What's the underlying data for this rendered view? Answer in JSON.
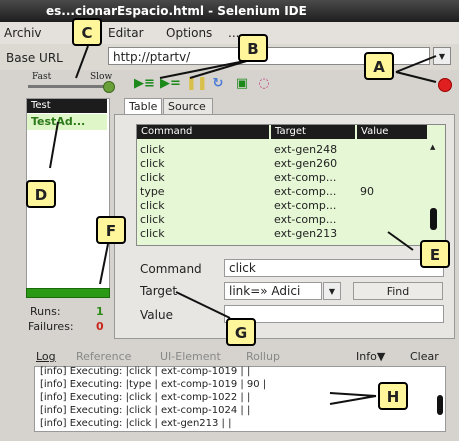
{
  "window": {
    "title": "es...cionarEspacio.html - Selenium IDE"
  },
  "menu": {
    "items": [
      "Archiv",
      "Editar",
      "Options",
      "..."
    ]
  },
  "baseurl": {
    "label": "Base URL",
    "value": "http://ptartv/"
  },
  "speed": {
    "fast": "Fast",
    "slow": "Slow"
  },
  "toolbar": {
    "icons": [
      "play-all-icon",
      "play-current-icon",
      "pause-icon",
      "step-icon",
      "rollup-icon",
      "schedule-icon"
    ]
  },
  "testcases": {
    "header": "Test",
    "items": [
      "TestAd..."
    ]
  },
  "stats": {
    "runs_label": "Runs:",
    "runs_value": "1",
    "failures_label": "Failures:",
    "failures_value": "0"
  },
  "tabs": {
    "table": "Table",
    "source": "Source"
  },
  "table": {
    "headers": [
      "Command",
      "Target",
      "Value"
    ],
    "rows": [
      {
        "command": "click",
        "target": "ext-gen248",
        "value": ""
      },
      {
        "command": "click",
        "target": "ext-gen260",
        "value": ""
      },
      {
        "command": "click",
        "target": "ext-comp...",
        "value": ""
      },
      {
        "command": "type",
        "target": "ext-comp...",
        "value": "90"
      },
      {
        "command": "click",
        "target": "ext-comp...",
        "value": ""
      },
      {
        "command": "click",
        "target": "ext-comp...",
        "value": ""
      },
      {
        "command": "click",
        "target": "ext-gen213",
        "value": ""
      }
    ]
  },
  "editor": {
    "command_label": "Command",
    "command_value": "click",
    "target_label": "Target",
    "target_value": "link=» Adici",
    "find_label": "Find",
    "value_label": "Value",
    "value_value": ""
  },
  "log": {
    "tabs": [
      "Log",
      "Reference",
      "UI-Element",
      "Rollup"
    ],
    "info": "Info▼",
    "clear": "Clear",
    "lines": [
      "[info] Executing: |click | ext-comp-1019 | |",
      "[info] Executing: |type | ext-comp-1019 | 90 |",
      "[info] Executing: |click | ext-comp-1022 | |",
      "[info] Executing: |click | ext-comp-1024 | |",
      "[info] Executing: |click | ext-gen213 | |"
    ]
  },
  "callouts": {
    "a": "A",
    "b": "B",
    "c": "C",
    "d": "D",
    "e": "E",
    "f": "F",
    "g": "G",
    "h": "H"
  },
  "colors": {
    "callout_bg": "#fff59b",
    "table_bg": "#e6f7d6",
    "progress": "#2a9a14",
    "record": "#e02020"
  }
}
